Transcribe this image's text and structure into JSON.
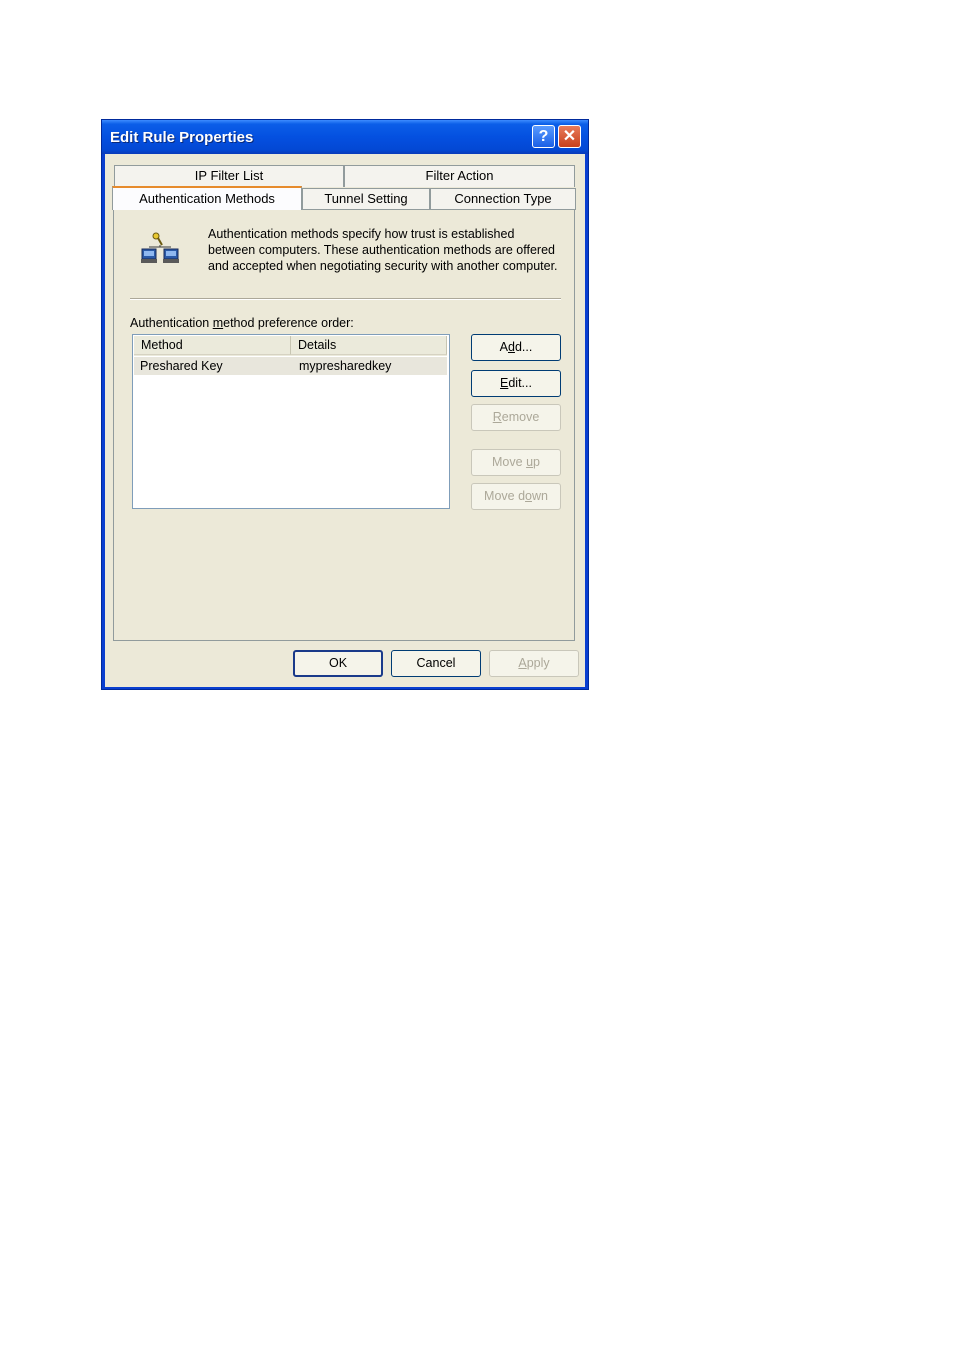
{
  "window": {
    "title": "Edit Rule Properties",
    "help_glyph": "?",
    "close_glyph": "✕"
  },
  "tabs": [
    {
      "label": "IP Filter List",
      "row": "back",
      "selected": false
    },
    {
      "label": "Filter Action",
      "row": "back",
      "selected": false
    },
    {
      "label": "Authentication Methods",
      "row": "front",
      "selected": true
    },
    {
      "label": "Tunnel Setting",
      "row": "front",
      "selected": false
    },
    {
      "label": "Connection Type",
      "row": "front",
      "selected": false
    }
  ],
  "panel": {
    "description": "Authentication methods specify how trust is established between computers. These authentication methods are offered and accepted when negotiating security with another computer.",
    "icon": "network-key-icon",
    "list_label_pre": "Authentication ",
    "list_label_accel": "m",
    "list_label_post": "ethod preference order:",
    "columns": [
      "Method",
      "Details"
    ],
    "rows": [
      {
        "method": "Preshared Key",
        "details": "mypresharedkey"
      }
    ],
    "buttons": {
      "add": {
        "pre": "A",
        "accel": "d",
        "post": "d...",
        "enabled": true
      },
      "edit": {
        "pre": "",
        "accel": "E",
        "post": "dit...",
        "enabled": true
      },
      "remove": {
        "pre": "",
        "accel": "R",
        "post": "emove",
        "enabled": false
      },
      "move_up": {
        "pre": "Move ",
        "accel": "u",
        "post": "p",
        "enabled": false
      },
      "move_down": {
        "pre": "Move d",
        "accel": "o",
        "post": "wn",
        "enabled": false
      }
    }
  },
  "footer": {
    "ok": "OK",
    "cancel": "Cancel",
    "apply_accel": "A",
    "apply_post": "pply",
    "apply_enabled": false
  },
  "colors": {
    "titlebar": "#0450e0",
    "dialog_bg": "#ece9d8",
    "active_tab_accent": "#e68b2c"
  }
}
